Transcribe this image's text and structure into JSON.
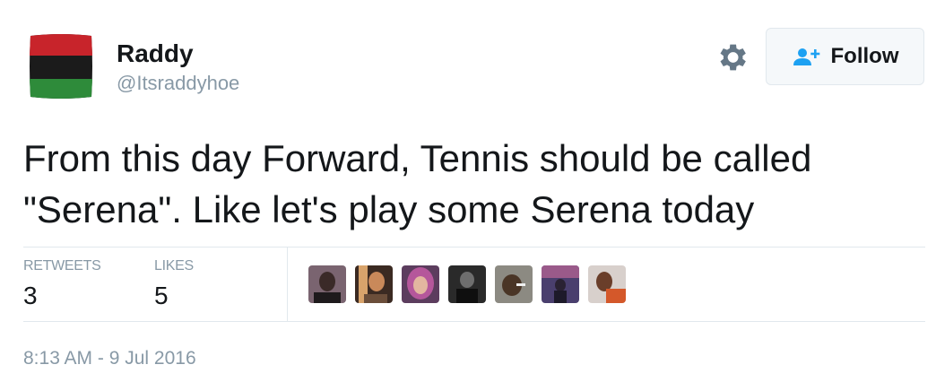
{
  "user": {
    "display_name": "Raddy",
    "handle": "@Itsraddyhoe"
  },
  "actions": {
    "follow_label": "Follow"
  },
  "tweet": {
    "line1": "From this day Forward, Tennis should be called",
    "line2": "\"Serena\". Like let's play some Serena today"
  },
  "stats": {
    "retweets_label": "RETWEETS",
    "retweets_count": "3",
    "likes_label": "LIKES",
    "likes_count": "5"
  },
  "timestamp": "8:13 AM - 9 Jul 2016",
  "colors": {
    "text": "#14171a",
    "muted": "#8899a6",
    "accent": "#1da1f2",
    "border": "#e1e8ed"
  },
  "icons": [
    "gear-icon",
    "add-user-icon"
  ]
}
